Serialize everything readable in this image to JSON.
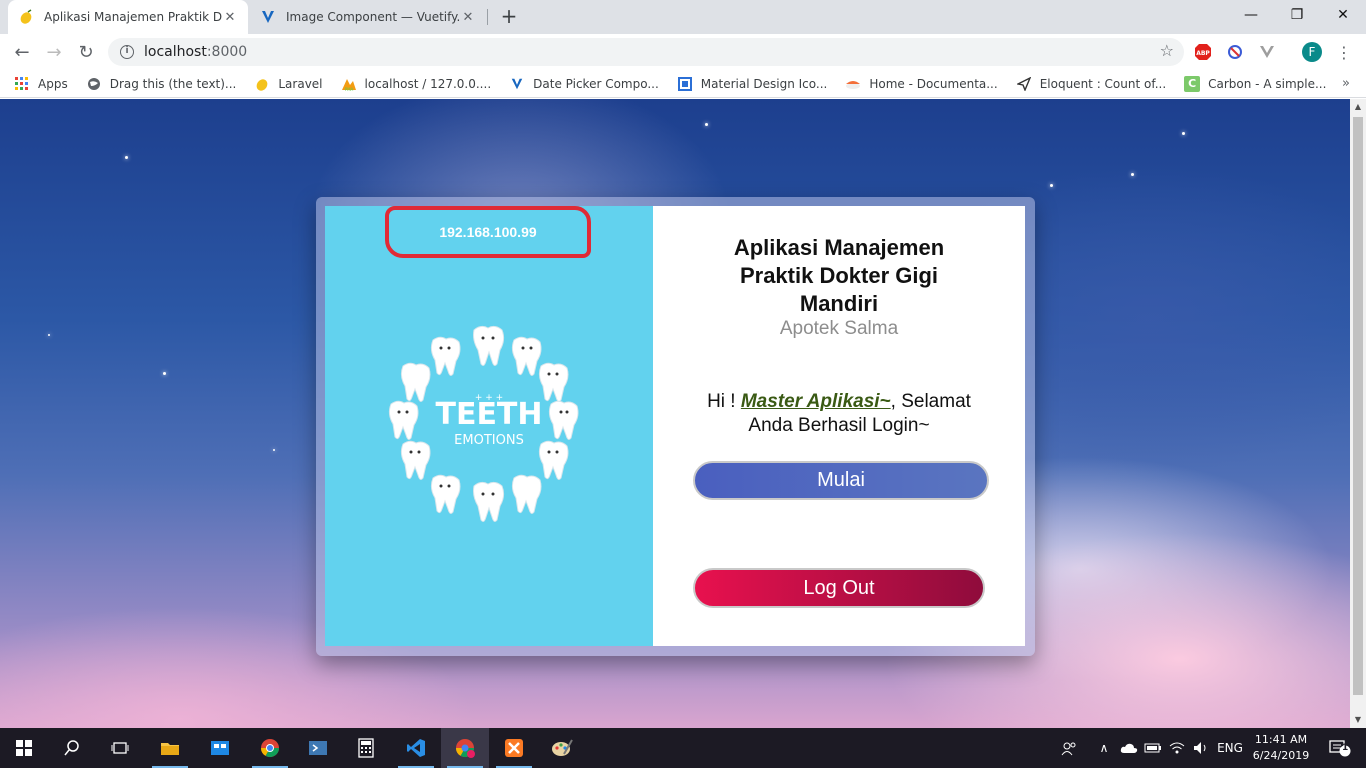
{
  "browser": {
    "tabs": [
      {
        "title": "Aplikasi Manajemen Praktik Dokter Gigi",
        "active": true
      },
      {
        "title": "Image Component — Vuetify.js",
        "active": false
      }
    ],
    "url_host": "localhost",
    "url_port": ":8000",
    "profile_initial": "F",
    "window_controls": {
      "minimize": "—",
      "maximize": "❐",
      "close": "✕"
    }
  },
  "bookmarks": [
    {
      "label": "Apps",
      "icon": "apps-grid-icon"
    },
    {
      "label": "Drag this (the text)...",
      "icon": "globe-icon"
    },
    {
      "label": "Laravel",
      "icon": "mango-icon"
    },
    {
      "label": "localhost / 127.0.0....",
      "icon": "phpmyadmin-icon"
    },
    {
      "label": "Date Picker Compo...",
      "icon": "vuetify-icon"
    },
    {
      "label": "Material Design Ico...",
      "icon": "material-icon"
    },
    {
      "label": "Home - Documenta...",
      "icon": "sushi-icon"
    },
    {
      "label": "Eloquent : Count of...",
      "icon": "plane-icon"
    },
    {
      "label": "Carbon - A simple...",
      "icon": "carbon-icon"
    }
  ],
  "card": {
    "ip_address": "192.168.100.99",
    "logo_line1": "TEETH",
    "logo_line2": "EMOTIONS",
    "app_title": "Aplikasi Manajemen Praktik Dokter Gigi Mandiri",
    "app_subtitle": "Apotek Salma",
    "greeting_prefix": "Hi ! ",
    "user_name": "Master Aplikasi~",
    "greeting_suffix": ", Selamat Anda Berhasil Login~",
    "start_button": "Mulai",
    "logout_button": "Log Out"
  },
  "taskbar": {
    "language": "ENG",
    "time": "11:41 AM",
    "date": "6/24/2019",
    "notification_count": "1"
  },
  "colors": {
    "card_left_bg": "#62d2ee",
    "start_button": "#4a5fbf",
    "logout_button": "#e8114e",
    "ip_highlight": "#e02a36"
  }
}
